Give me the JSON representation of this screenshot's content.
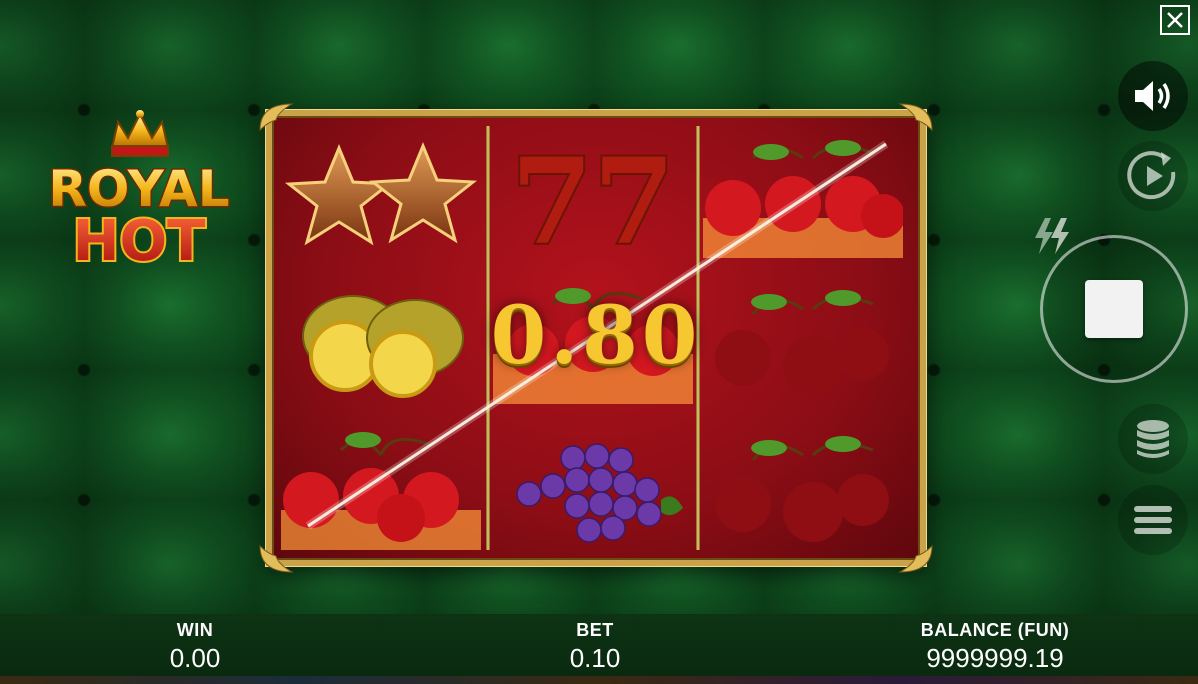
{
  "game": {
    "title_line1": "ROYAL",
    "title_line2": "HOT"
  },
  "controls": {
    "close": "close-icon",
    "sound": "speaker-icon",
    "autoplay": "autoplay-icon",
    "turbo": "lightning-icon",
    "spin": "stop-icon",
    "bet_settings": "coins-icon",
    "menu": "hamburger-icon"
  },
  "reels": [
    [
      "stars",
      "lemons",
      "cherries-fire"
    ],
    [
      "sevens",
      "cherries-fire",
      "grapes"
    ],
    [
      "cherries-fire",
      "cherries",
      "cherries"
    ]
  ],
  "win_display": {
    "amount": "0.80"
  },
  "status_bar": {
    "win_label": "WIN",
    "win_value": "0.00",
    "bet_label": "BET",
    "bet_value": "0.10",
    "balance_label": "BALANCE (FUN)",
    "balance_value": "9999999.19"
  },
  "colors": {
    "felt": "#125a24",
    "reel_bg": "#8b0d15",
    "gold": "#f6c731",
    "frame": "#c9a24a"
  }
}
